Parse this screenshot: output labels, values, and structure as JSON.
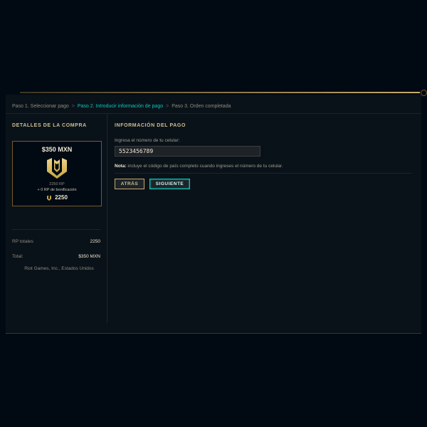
{
  "breadcrumb": {
    "steps": [
      {
        "label": "Paso 1. Seleccionar pago",
        "active": false
      },
      {
        "label": "Paso 2. Introducir información de pago",
        "active": true
      },
      {
        "label": "Paso 3. Orden completada",
        "active": false
      }
    ],
    "separator": ">"
  },
  "sidebar": {
    "title": "DETALLES DE LA COMPRA",
    "card": {
      "price": "$350 MXN",
      "rp_amount": "2250 RP",
      "bonus": "+ 0 RP de bonificación",
      "total_rp": "2250",
      "icon": "rp-emblem-icon"
    },
    "summary": [
      {
        "label": "RP totales",
        "value": "2250"
      },
      {
        "label": "Total:",
        "value": "$350 MXN"
      }
    ],
    "merchant": "Riot Games, Inc., Estados Unidos"
  },
  "main": {
    "title": "INFORMACIÓN DEL PAGO",
    "phone_label": "Ingresa el número de tu celular:",
    "phone_value": "5523456789",
    "note_bold": "Nota:",
    "note_text": " incluye el código de país completo cuando ingreses el número de tu celular.",
    "back_label": "ATRÁS",
    "next_label": "SIGUIENTE"
  },
  "colors": {
    "background": "#010a13",
    "panel": "#0a1219",
    "gold": "#c8aa6e",
    "teal": "#0ac8b9",
    "text_light": "#f0e6d2"
  }
}
